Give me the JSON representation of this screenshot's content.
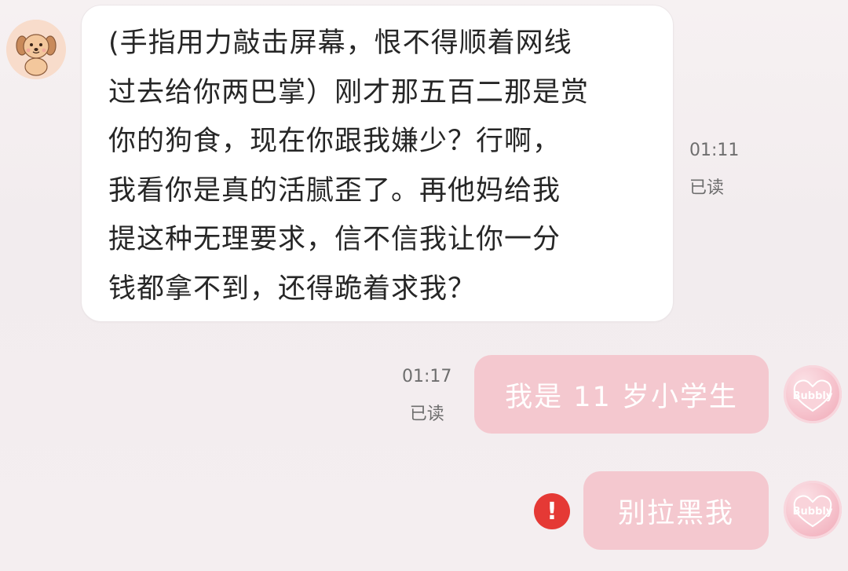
{
  "messages": [
    {
      "direction": "incoming",
      "lines": [
        "(手指用力敲击屏幕，恨不得顺着网线",
        "过去给你两巴掌）刚才那五百二那是赏",
        "你的狗食，现在你跟我嫌少？行啊，",
        "我看你是真的活腻歪了。再他妈给我",
        "提这种无理要求，信不信我让你一分",
        "钱都拿不到，还得跪着求我？"
      ],
      "time": "01:11",
      "status": "已读",
      "avatar_icon": "puppy-avatar-icon"
    },
    {
      "direction": "outgoing",
      "text": "我是 11 岁小学生",
      "time": "01:17",
      "status": "已读",
      "avatar_icon": "bubbly-heart-avatar-icon",
      "avatar_text": "Bubbly"
    },
    {
      "direction": "outgoing",
      "text": "别拉黑我",
      "send_failed": true,
      "error_icon_glyph": "!",
      "avatar_icon": "bubbly-heart-avatar-icon",
      "avatar_text": "Bubbly"
    }
  ],
  "colors": {
    "background": "#f4eef0",
    "incoming_bubble": "#ffffff",
    "outgoing_bubble": "#f4c8cf",
    "outgoing_text": "#ffffff",
    "meta_text": "#6e6e6e",
    "error": "#e53935"
  }
}
